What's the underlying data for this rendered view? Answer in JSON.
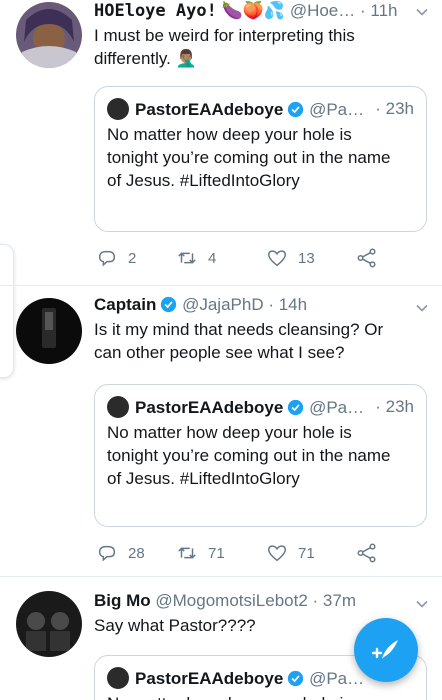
{
  "tweets": [
    {
      "name": "HOEloye Ayo!",
      "handle": "@Hoe…",
      "time": "· 11h",
      "text": "I must be weird for interpreting this differently. 🤦🏽‍♂️",
      "name_emojis": "🍆🍑💦",
      "quote": {
        "name": "PastorEAAdeboye",
        "handle": "@Pa…",
        "time": "· 23h",
        "text": "No matter how deep your hole is tonight you’re coming out in the name of Jesus. #LiftedIntoGlory"
      },
      "actions": {
        "replies": "2",
        "retweets": "4",
        "likes": "13"
      }
    },
    {
      "name": "Captain",
      "handle": "@JajaPhD",
      "time": "· 14h",
      "text": "Is it my mind that needs cleansing? Or can other people see what I see?",
      "quote": {
        "name": "PastorEAAdeboye",
        "handle": "@Pa…",
        "time": "· 23h",
        "text": "No matter how deep your hole is tonight you’re coming out in the name of Jesus. #LiftedIntoGlory"
      },
      "actions": {
        "replies": "28",
        "retweets": "71",
        "likes": "71"
      }
    },
    {
      "name": "Big Mo",
      "handle": "@MogomotsiLebot2",
      "time": "· 37m",
      "text": "Say what Pastor????",
      "quote": {
        "name": "PastorEAAdeboye",
        "handle": "@Pa…",
        "time": "",
        "text": "No matter how deep your hole is"
      }
    }
  ],
  "colors": {
    "accent": "#1da1f2",
    "muted": "#657786",
    "border": "#ccd6dd"
  },
  "icons": [
    "reply-icon",
    "retweet-icon",
    "like-icon",
    "share-icon",
    "verified-icon",
    "chevron-down-icon",
    "compose-icon"
  ]
}
